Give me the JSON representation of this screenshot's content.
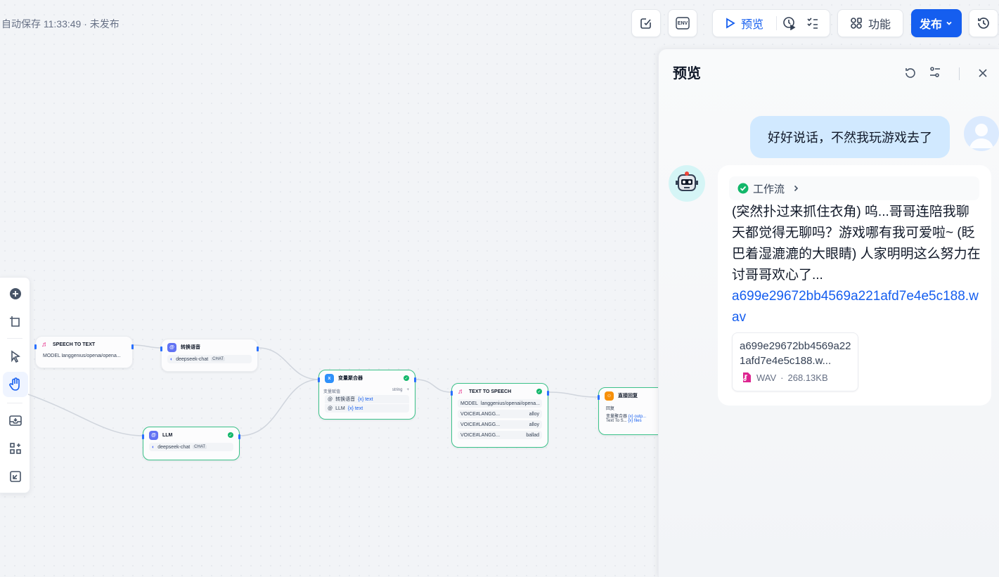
{
  "status": "自动保存 11:33:49 · 未发布",
  "toolbar": {
    "preview_label": "预览",
    "features_label": "功能",
    "publish_label": "发布",
    "env_label": "ENV"
  },
  "nodes": {
    "stt": {
      "title": "SPEECH TO TEXT",
      "model_label": "MODEL",
      "model_value": "langgenius/openai/opena..."
    },
    "convert": {
      "title": "转换语音",
      "model": "deepseek-chat",
      "tag": "CHAT"
    },
    "llm": {
      "title": "LLM",
      "model": "deepseek-chat",
      "tag": "CHAT"
    },
    "agg": {
      "title": "变量聚合器",
      "var_label": "变量赋值",
      "var_type": "string",
      "rows": [
        {
          "src": "转换语音",
          "var": "{x} text"
        },
        {
          "src": "LLM",
          "var": "{x} text"
        }
      ]
    },
    "tts": {
      "title": "TEXT TO SPEECH",
      "model_label": "MODEL",
      "model_value": "langgenius/openai/opena...",
      "rows": [
        {
          "k": "VOICE#LANGG...",
          "v": "alloy"
        },
        {
          "k": "VOICE#LANGG...",
          "v": "alloy"
        },
        {
          "k": "VOICE#LANGG...",
          "v": "ballad"
        }
      ]
    },
    "reply": {
      "title": "直接回复",
      "sub": "回复",
      "rows": [
        {
          "src": "变量聚合器",
          "var": "{x} outp..."
        },
        {
          "src": "Text To S...",
          "var": "{x} files"
        }
      ]
    }
  },
  "preview": {
    "title": "预览",
    "user_message": "好好说话，不然我玩游戏去了",
    "workflow_label": "工作流",
    "answer_text": "(突然扑过来抓住衣角) 呜...哥哥连陪我聊天都觉得无聊吗？游戏哪有我可爱啦~ (眨巴着湿漉漉的大眼睛) 人家明明这么努力在讨哥哥欢心了...",
    "answer_link": "a699e29672bb4569a221afd7e4e5c188.wav",
    "file_name": "a699e29672bb4569a221afd7e4e5c188.w...",
    "file_type": "WAV",
    "file_size": "268.13KB"
  },
  "colors": {
    "accent": "#155eef",
    "success": "#12b76a",
    "user_bubble": "#d1e9ff"
  }
}
